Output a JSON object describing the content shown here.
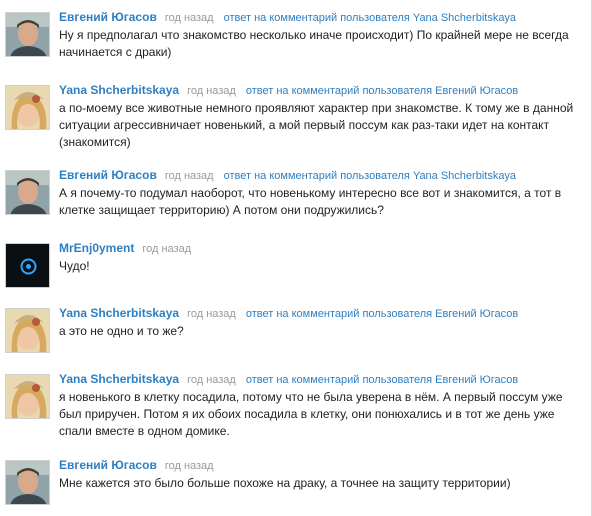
{
  "comments": [
    {
      "author": "Евгений Югасов",
      "avatar": "man-avatar",
      "time": "год назад",
      "reply": "ответ на комментарий пользователя Yana Shcherbitskaya",
      "text": "Ну я предполагал что знакомство несколько иначе происходит) По крайней мере не всегда начинается с драки)"
    },
    {
      "author": "Yana Shcherbitskaya",
      "avatar": "girl-avatar",
      "time": "год назад",
      "reply": "ответ на комментарий пользователя Евгений Югасов",
      "text": "а по-моему все животные немного проявляют характер при знакомстве. К тому же в данной ситуации агрессивничает новенький, а мой первый поссум как раз-таки идет на контакт (знакомится)"
    },
    {
      "author": "Евгений Югасов",
      "avatar": "man-avatar",
      "time": "год назад",
      "reply": "ответ на комментарий пользователя Yana Shcherbitskaya",
      "text": "А я почему-то подумал наоборот, что новенькому интересно все вот и знакомится, а тот в клетке защищает территорию) А потом они подружились?"
    },
    {
      "author": "MrEnj0yment",
      "avatar": "circle-avatar",
      "time": "год назад",
      "reply": "",
      "text": "Чудо!"
    },
    {
      "author": "Yana Shcherbitskaya",
      "avatar": "girl-avatar",
      "time": "год назад",
      "reply": "ответ на комментарий пользователя Евгений Югасов",
      "text": "а это не одно и то же?"
    },
    {
      "author": "Yana Shcherbitskaya",
      "avatar": "girl-avatar",
      "time": "год назад",
      "reply": "ответ на комментарий пользователя Евгений Югасов",
      "text": "я новенького в клетку посадила, потому что не была уверена в нём. А первый поссум уже был приручен. Потом я их обоих посадила в клетку, они понюхались и в тот же день уже спали вместе в одном домике."
    },
    {
      "author": "Евгений Югасов",
      "avatar": "man-avatar",
      "time": "год назад",
      "reply": "",
      "text": "Мне кажется это было больше похоже на драку, а точнее на защиту территории)"
    }
  ]
}
